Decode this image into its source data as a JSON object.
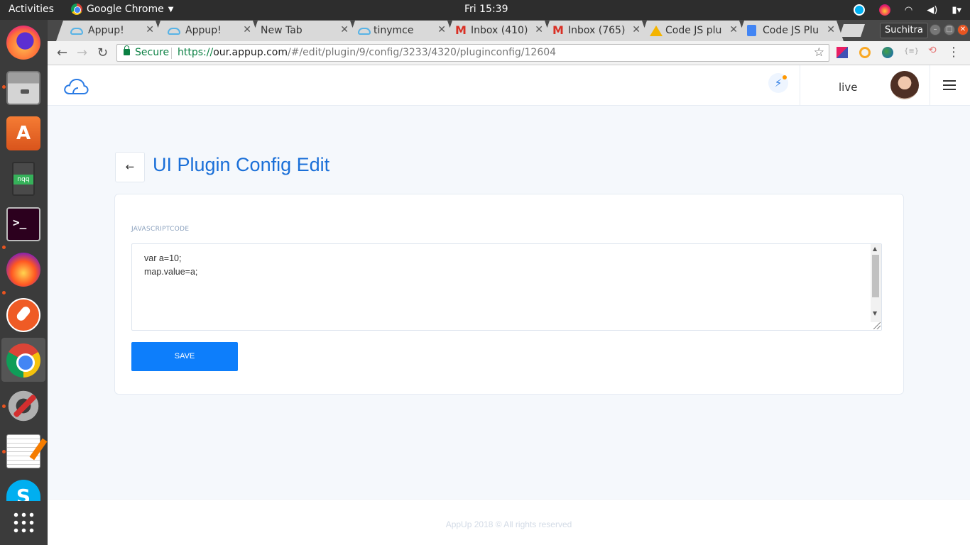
{
  "system_bar": {
    "activities": "Activities",
    "app_name": "Google Chrome",
    "clock": "Fri 15:39"
  },
  "dock": {
    "items": [
      "Firefox",
      "Files",
      "Ubuntu Software",
      "Notepadqq",
      "Terminal",
      "App",
      "Postman",
      "Google Chrome",
      "Settings",
      "Text Editor",
      "Skype",
      "Show Applications"
    ]
  },
  "browser": {
    "tabs": [
      {
        "title": "Appup!",
        "icon": "cloud-icon",
        "active": false
      },
      {
        "title": "Appup!",
        "icon": "cloud-icon",
        "active": true
      },
      {
        "title": "New Tab",
        "icon": "",
        "active": false
      },
      {
        "title": "tinymce",
        "icon": "cloud-icon",
        "active": false
      },
      {
        "title": "Inbox (410)",
        "icon": "gmail-icon",
        "active": false
      },
      {
        "title": "Inbox (765)",
        "icon": "gmail-icon",
        "active": false
      },
      {
        "title": "Code JS plu",
        "icon": "drive-icon",
        "active": false
      },
      {
        "title": "Code JS Plu",
        "icon": "docs-icon",
        "active": false
      }
    ],
    "profile_name": "Suchitra",
    "secure_label": "Secure",
    "url_scheme": "https://",
    "url_host": "our.appup.com",
    "url_path": "/#/edit/plugin/9/config/3233/4320/pluginconfig/12604"
  },
  "app": {
    "environment": "live",
    "page_title": "UI Plugin Config Edit",
    "field_label": "JAVASCRIPTCODE",
    "code_lines": [
      "var a=10;",
      "map.value=a;"
    ],
    "save_label": "SAVE",
    "footer": "AppUp 2018 © All rights reserved",
    "accent_color": "#1a6fd8",
    "button_color": "#0d7efb"
  }
}
